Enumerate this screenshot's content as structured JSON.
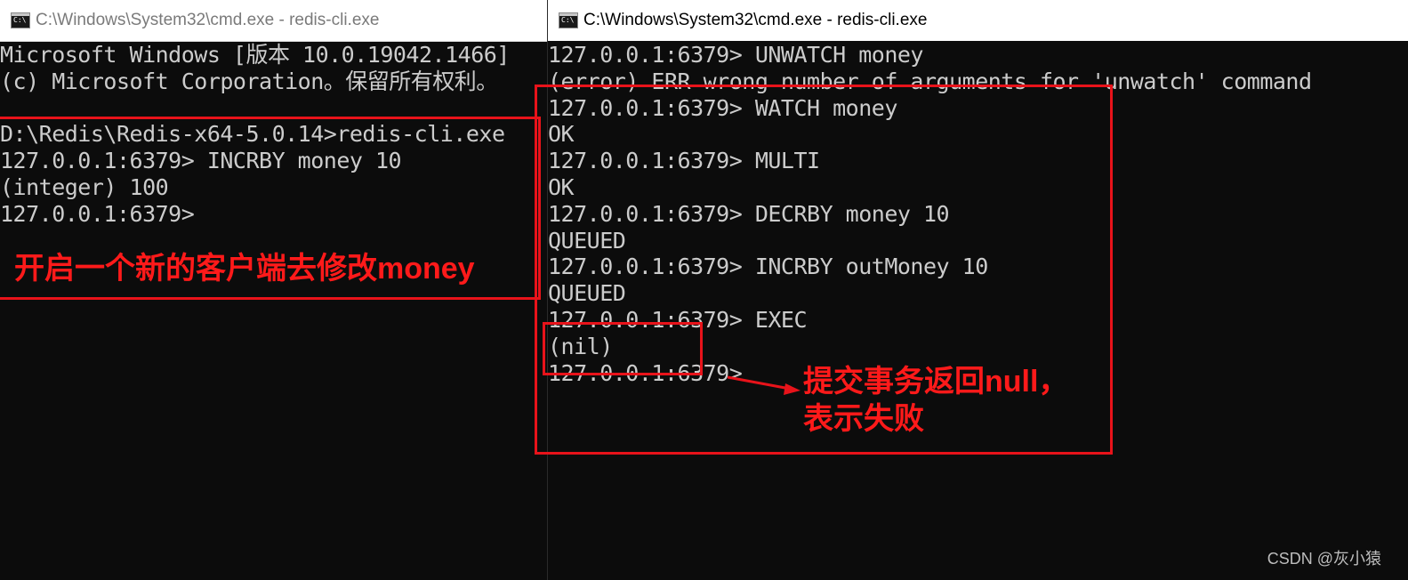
{
  "left_window": {
    "title": "C:\\Windows\\System32\\cmd.exe - redis-cli.exe",
    "lines": [
      "Microsoft Windows [版本 10.0.19042.1466]",
      "(c) Microsoft Corporation。保留所有权利。",
      "",
      "D:\\Redis\\Redis-x64-5.0.14>redis-cli.exe",
      "127.0.0.1:6379> INCRBY money 10",
      "(integer) 100",
      "127.0.0.1:6379>"
    ],
    "annotation": "开启一个新的客户端去修改money"
  },
  "right_window": {
    "title": "C:\\Windows\\System32\\cmd.exe - redis-cli.exe",
    "lines": [
      "127.0.0.1:6379> UNWATCH money",
      "(error) ERR wrong number of arguments for 'unwatch' command",
      "127.0.0.1:6379> WATCH money",
      "OK",
      "127.0.0.1:6379> MULTI",
      "OK",
      "127.0.0.1:6379> DECRBY money 10",
      "QUEUED",
      "127.0.0.1:6379> INCRBY outMoney 10",
      "QUEUED",
      "127.0.0.1:6379> EXEC",
      "(nil)",
      "127.0.0.1:6379>"
    ],
    "annotation_line1": "提交事务返回null，",
    "annotation_line2": "表示失败"
  },
  "watermark": "CSDN @灰小猿",
  "icons": {
    "console_icon": "C:\\"
  },
  "colors": {
    "console_bg": "#0c0c0c",
    "console_text": "#cccccc",
    "annotation_red": "#e8131a"
  }
}
